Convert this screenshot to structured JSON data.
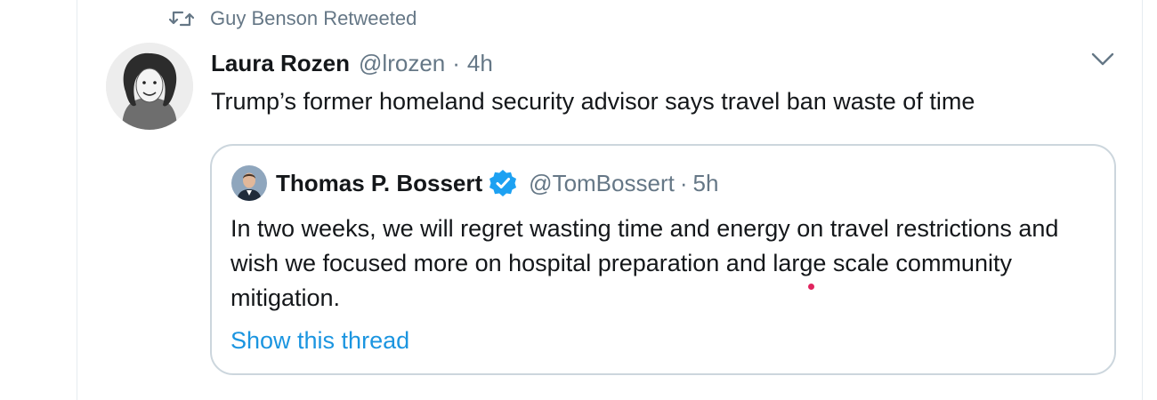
{
  "retweet": {
    "icon": "retweet-icon",
    "label": "Guy Benson Retweeted"
  },
  "tweet": {
    "author_name": "Laura Rozen",
    "author_handle": "@lrozen",
    "separator": "·",
    "time": "4h",
    "text": "Trump’s former homeland security advisor says travel ban waste of time",
    "menu_icon": "chevron-down-icon"
  },
  "quote": {
    "author_name": "Thomas P. Bossert",
    "verified_icon": "verified-badge-icon",
    "author_handle": "@TomBossert",
    "separator": "·",
    "time": "5h",
    "text": "In two weeks, we will regret wasting time and energy on travel restrictions and wish we focused more on hospital preparation and large scale community mitigation.",
    "show_thread": "Show this thread"
  },
  "colors": {
    "text": "#14171a",
    "secondary": "#657786",
    "link": "#1b95e0",
    "verified": "#1da1f2",
    "border": "#ccd6dd"
  }
}
